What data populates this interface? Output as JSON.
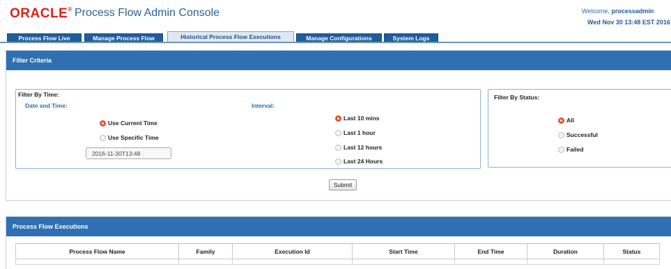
{
  "header": {
    "logo_text": "ORACLE",
    "logo_mark": "®",
    "app_title": "Process Flow Admin Console",
    "welcome_prefix": "Welcome, ",
    "welcome_user": "processadmin",
    "datetime": "Wed Nov 30 13:48 EST 2016"
  },
  "tabs": [
    {
      "label": "Process Flow Live",
      "active": false
    },
    {
      "label": "Manage Process Flow",
      "active": false
    },
    {
      "label": "Historical Process Flow Executions",
      "active": true
    },
    {
      "label": "Manage Configurations",
      "active": false
    },
    {
      "label": "System Logs",
      "active": false
    }
  ],
  "filter": {
    "title": "Filter Criteria",
    "by_time": {
      "legend": "Filter By Time:",
      "date_label": "Date and Time:",
      "interval_label": "Interval:",
      "time_options": [
        {
          "label": "Use Current Time",
          "selected": true
        },
        {
          "label": "Use Specific Time",
          "selected": false
        }
      ],
      "datetime_value": "2016-11-30T13:48",
      "interval_options": [
        {
          "label": "Last 10 mins",
          "selected": true
        },
        {
          "label": "Last 1 hour",
          "selected": false
        },
        {
          "label": "Last 12 hours",
          "selected": false
        },
        {
          "label": "Last 24 Hours",
          "selected": false
        }
      ]
    },
    "by_status": {
      "legend": "Filter By Status:",
      "options": [
        {
          "label": "All",
          "selected": true
        },
        {
          "label": "Successful",
          "selected": false
        },
        {
          "label": "Failed",
          "selected": false
        }
      ]
    },
    "submit_label": "Submit"
  },
  "executions": {
    "title": "Process Flow Executions",
    "columns": [
      "Process Flow Name",
      "Family",
      "Execution Id",
      "Start Time",
      "End Time",
      "Duration",
      "Status"
    ]
  },
  "colors": {
    "brand_red": "#e0201b",
    "panel_header_blue": "#2e70b1",
    "tab_blue": "#1f5e9b",
    "radio_selected": "#e6542a"
  }
}
